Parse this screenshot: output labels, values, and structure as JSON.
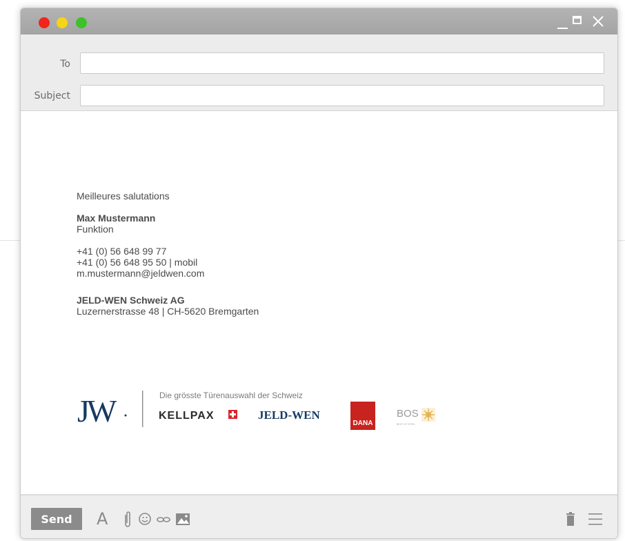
{
  "compose": {
    "to_label": "To",
    "to_value": "",
    "subject_label": "Subject",
    "subject_value": ""
  },
  "signature": {
    "greeting": "Meilleures salutations",
    "name": "Max Mustermann",
    "role": "Funktion",
    "phone": "+41 (0) 56 648 99 77",
    "mobile": "+41 (0) 56 648 95 50 | mobil",
    "email": "m.mustermann@jeldwen.com",
    "company": "JELD-WEN Schweiz AG",
    "address": "Luzernerstrasse 48 | CH-5620 Bremgarten"
  },
  "brand": {
    "monogram": "JW",
    "tagline": "Die grösste Türenauswahl der Schweiz",
    "brands": [
      "KELLPAX",
      "JELD-WEN",
      "DANA",
      "BOS"
    ],
    "bos_sub": "BEST OF STEEL"
  },
  "footer": {
    "send_label": "Send",
    "format_icon_glyph": "A"
  },
  "colors": {
    "window_red": "#f0261c",
    "window_yellow": "#f7d417",
    "window_green": "#3ec12a",
    "jw_blue": "#163a64",
    "kellpax_red": "#d7262c",
    "dana_red": "#c8231e",
    "bos_gold": "#e4b452"
  },
  "icons": [
    "minimize-icon",
    "maximize-icon",
    "close-icon",
    "font-format-icon",
    "attachment-icon",
    "emoji-icon",
    "link-icon",
    "image-icon",
    "trash-icon",
    "menu-icon"
  ]
}
